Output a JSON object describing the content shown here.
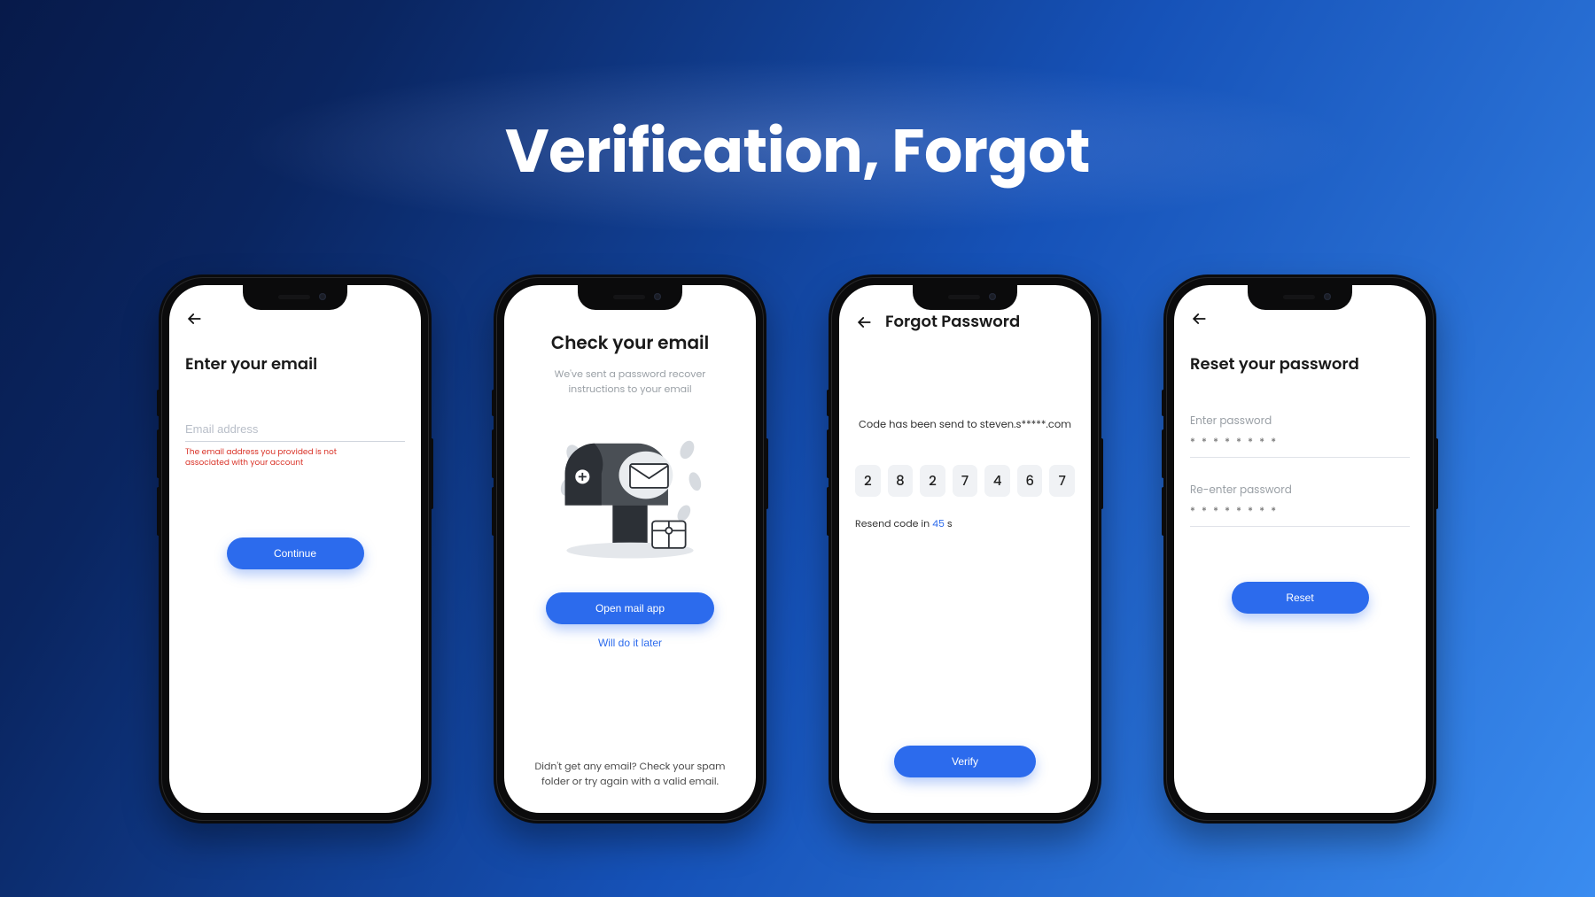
{
  "page": {
    "title": "Verification, Forgot"
  },
  "screens": {
    "enterEmail": {
      "heading": "Enter your email",
      "emailPlaceholder": "Email address",
      "errorMessage": "The email address you provided is not associated with your account",
      "continueLabel": "Continue"
    },
    "checkEmail": {
      "heading": "Check your email",
      "subtext": "We've sent a password recover instructions to your email",
      "openMailLabel": "Open mail app",
      "laterLabel": "Will do it later",
      "footerNote": "Didn't get any email? Check your spam folder or try again with a valid email."
    },
    "forgotPassword": {
      "heading": "Forgot Password",
      "sentTo": "Code has been send to steven.s*****.com",
      "code": [
        "2",
        "8",
        "2",
        "7",
        "4",
        "6",
        "7"
      ],
      "resendPrefix": "Resend code in ",
      "resendSeconds": "45",
      "resendSuffix": " s",
      "verifyLabel": "Verify"
    },
    "resetPassword": {
      "heading": "Reset your password",
      "enterLabel": "Enter password",
      "reenterLabel": "Re-enter password",
      "maskValue": "* * * * * * * *",
      "resetLabel": "Reset"
    }
  }
}
